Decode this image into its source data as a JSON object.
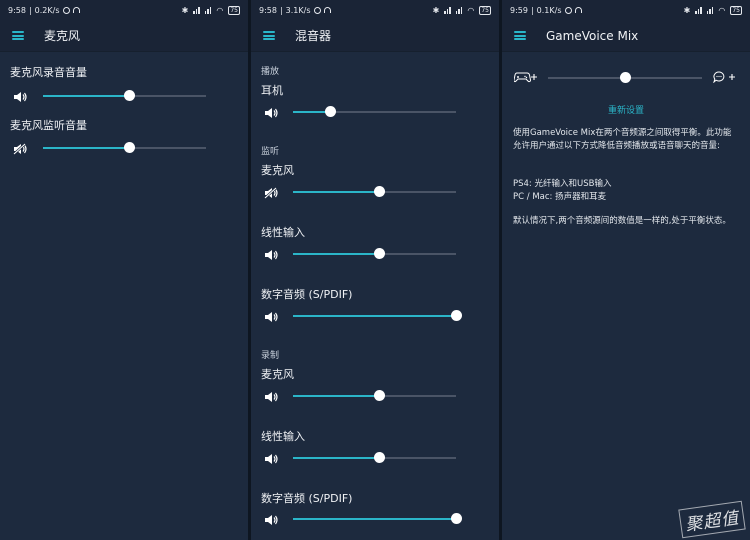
{
  "screens": [
    {
      "status": {
        "time": "9:58",
        "speed": "0.2K/s",
        "battery": "75"
      },
      "title": "麦克风",
      "rows": [
        {
          "label": "麦克风录音音量",
          "muted": false,
          "level": 0.53
        },
        {
          "label": "麦克风监听音量",
          "muted": true,
          "level": 0.53
        }
      ]
    },
    {
      "status": {
        "time": "9:58",
        "speed": "3.1K/s",
        "battery": "75"
      },
      "title": "混音器",
      "sections": [
        {
          "heading": "播放",
          "rows": [
            {
              "label": "耳机",
              "muted": false,
              "level": 0.23
            }
          ]
        },
        {
          "heading": "监听",
          "rows": [
            {
              "label": "麦克风",
              "muted": true,
              "level": 0.53
            },
            {
              "label": "线性输入",
              "muted": false,
              "level": 0.53
            },
            {
              "label": "数字音频 (S/PDIF)",
              "muted": false,
              "level": 1.0
            }
          ]
        },
        {
          "heading": "录制",
          "rows": [
            {
              "label": "麦克风",
              "muted": false,
              "level": 0.53
            },
            {
              "label": "线性输入",
              "muted": false,
              "level": 0.53
            },
            {
              "label": "数字音频 (S/PDIF)",
              "muted": false,
              "level": 1.0
            }
          ]
        }
      ]
    },
    {
      "status": {
        "time": "9:59",
        "speed": "0.1K/s",
        "battery": "75"
      },
      "title": "GameVoice Mix",
      "balance": 0.5,
      "left_icon": "gamepad-plus-icon",
      "right_icon": "chat-plus-icon",
      "reset_label": "重新设置",
      "paragraphs": [
        "使用GameVoice Mix在两个音频源之间取得平衡。此功能允许用户通过以下方式降低音频播放或语音聊天的音量:",
        "PS4: 光纤输入和USB输入",
        "PC / Mac: 扬声器和耳麦",
        "默认情况下,两个音频源间的数值是一样的,处于平衡状态。"
      ]
    }
  ],
  "watermark": "聚超值",
  "colors": {
    "accent": "#2bb5c8",
    "panel": "#1d2a3e",
    "appbar": "#1a2436"
  }
}
